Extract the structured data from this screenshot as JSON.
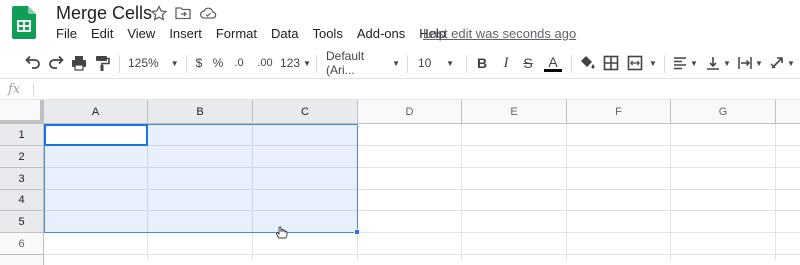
{
  "app": {
    "doc_title": "Merge Cells",
    "last_edit": "Last edit was seconds ago",
    "brand_color": "#0f9d58"
  },
  "menu": [
    "File",
    "Edit",
    "View",
    "Insert",
    "Format",
    "Data",
    "Tools",
    "Add-ons",
    "Help"
  ],
  "toolbar": {
    "zoom": "125%",
    "currency": "$",
    "percent": "%",
    "dec_less": ".0",
    "dec_more": ".00",
    "more_formats": "123",
    "font": "Default (Ari...",
    "font_size": "10",
    "bold": "B",
    "italic": "I",
    "strike": "S",
    "text_color": "A"
  },
  "formula_bar": {
    "fx": "fx",
    "value": ""
  },
  "sheet": {
    "columns": [
      "A",
      "B",
      "C",
      "D",
      "E",
      "F",
      "G"
    ],
    "rows": [
      "1",
      "2",
      "3",
      "4",
      "5",
      "6"
    ],
    "selected_range": "A1:C5",
    "selection_color": "#1a73e8"
  }
}
